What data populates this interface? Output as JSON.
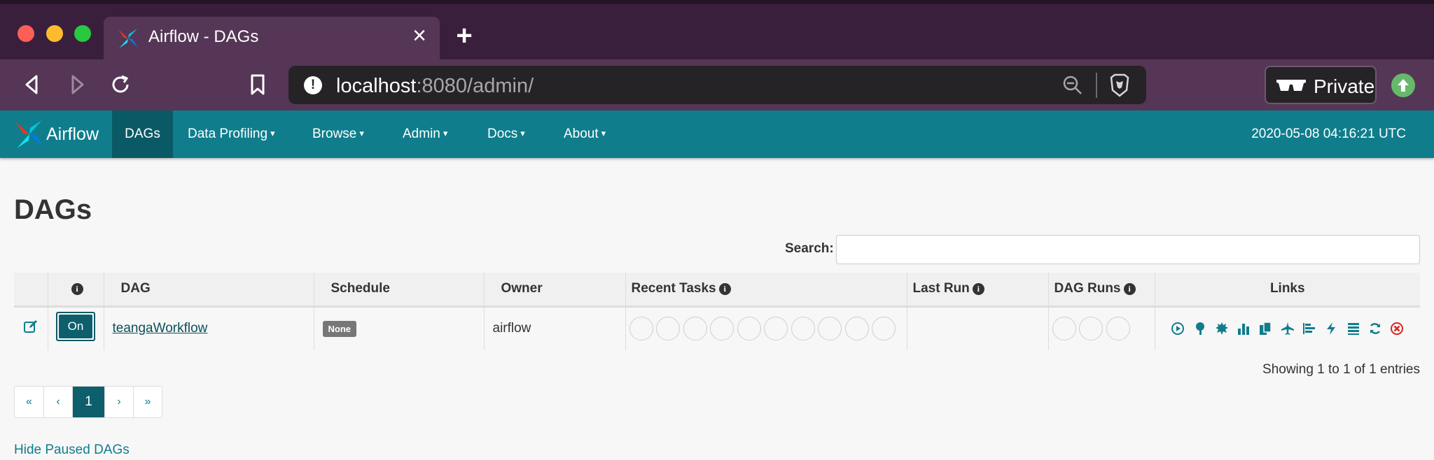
{
  "browser": {
    "tab_title": "Airflow - DAGs",
    "url_host": "localhost",
    "url_rest": ":8080/admin/",
    "private_label": "Private"
  },
  "navbar": {
    "brand": "Airflow",
    "items": [
      {
        "label": "DAGs",
        "caret": false
      },
      {
        "label": "Data Profiling",
        "caret": true
      },
      {
        "label": "Browse",
        "caret": true
      },
      {
        "label": "Admin",
        "caret": true
      },
      {
        "label": "Docs",
        "caret": true
      },
      {
        "label": "About",
        "caret": true
      }
    ],
    "clock": "2020-05-08 04:16:21 UTC"
  },
  "page": {
    "title": "DAGs",
    "search_label": "Search:",
    "search_value": ""
  },
  "table": {
    "headers": {
      "dag": "DAG",
      "schedule": "Schedule",
      "owner": "Owner",
      "recent_tasks": "Recent Tasks",
      "last_run": "Last Run",
      "dag_runs": "DAG Runs",
      "links": "Links"
    },
    "rows": [
      {
        "toggle": "On",
        "dag": "teangaWorkflow",
        "schedule": "None",
        "owner": "airflow",
        "last_run": "",
        "recent_task_circles": 10,
        "dag_run_circles": 3
      }
    ]
  },
  "footer": {
    "showing": "Showing 1 to 1 of 1 entries",
    "pagination": [
      "«",
      "‹",
      "1",
      "›",
      "»"
    ],
    "active_page": "1",
    "hide_paused": "Hide Paused DAGs"
  },
  "colors": {
    "navbar": "#0f7d8c",
    "nav_active": "#0a5a65",
    "link": "#0f7d8c",
    "browser_frame": "#553656"
  },
  "icons": {
    "links": [
      "trigger-dag-icon",
      "tree-view-icon",
      "graph-view-icon",
      "task-duration-icon",
      "task-tries-icon",
      "landing-times-icon",
      "gantt-icon",
      "code-icon",
      "logs-icon",
      "refresh-icon",
      "delete-icon"
    ]
  }
}
